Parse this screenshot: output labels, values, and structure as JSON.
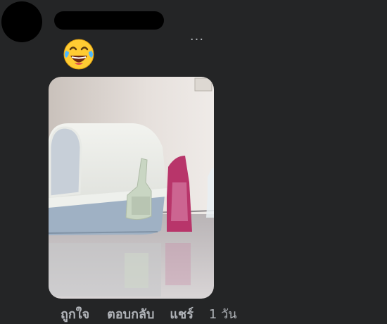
{
  "comment": {
    "emoji_icon": "face-with-tears-of-joy-icon",
    "more_icon": "ellipsis-icon",
    "more_label": "···"
  },
  "photo": {
    "subject": "litter-box-photo"
  },
  "actions": {
    "like_label": "ถูกใจ",
    "reply_label": "ตอบกลับ",
    "share_label": "แชร์",
    "time_label": "1 วัน"
  }
}
